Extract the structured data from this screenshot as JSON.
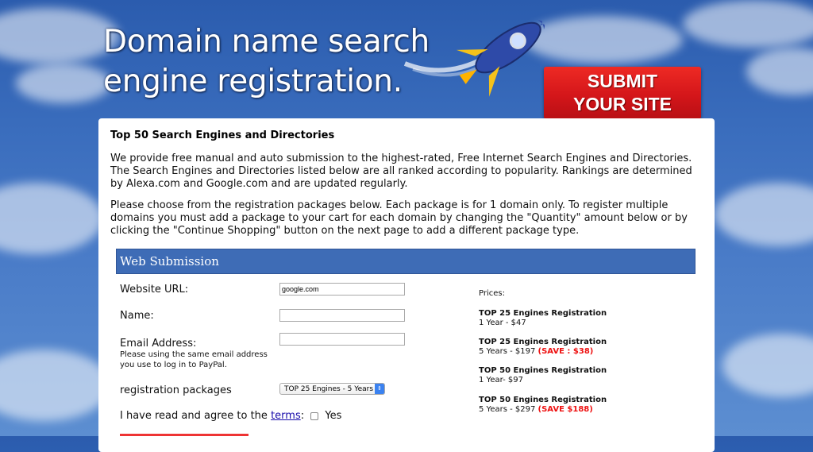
{
  "header": {
    "headline_line1": "Domain name search",
    "headline_line2": "engine registration.",
    "submit_line1": "SUBMIT",
    "submit_line2": "YOUR SITE"
  },
  "content": {
    "title": "Top 50 Search Engines and Directories",
    "paragraph1": "We provide free manual and auto submission to the highest-rated, Free Internet Search Engines and Directories. The Search Engines and Directories listed below are all ranked according to popularity. Rankings are determined by Alexa.com and Google.com and are updated regularly.",
    "paragraph2": "Please choose from the registration packages below. Each package is for 1 domain only. To register multiple domains you must add a package to your cart for each domain by changing the \"Quantity\" amount below or by clicking the \"Continue Shopping\" button on the next page to add a different package type."
  },
  "form": {
    "section_title": "Web Submission",
    "website_label": "Website URL:",
    "website_value": "google.com",
    "name_label": "Name:",
    "name_value": "",
    "email_label": "Email Address:",
    "email_value": "",
    "email_hint": "Please using the same email address you use to log in to PayPal.",
    "package_label": "registration packages",
    "package_selected": "TOP 25 Engines - 5 Years",
    "terms_prefix": "I have read and agree to the",
    "terms_link": "terms",
    "terms_colon": ":",
    "terms_yes": "Yes"
  },
  "prices": {
    "label": "Prices:",
    "items": [
      {
        "title": "TOP 25 Engines Registration",
        "detail": "1 Year - $47",
        "save": ""
      },
      {
        "title": "TOP 25 Engines Registration",
        "detail": "5 Years - $197",
        "save": "(SAVE : $38)"
      },
      {
        "title": "TOP 50 Engines Registration",
        "detail": "1 Year- $97",
        "save": ""
      },
      {
        "title": "TOP 50 Engines Registration",
        "detail": "5 Years - $297",
        "save": "(SAVE $188)"
      }
    ]
  },
  "colors": {
    "sky": "#3a6dbd",
    "submit_red": "#d4161a",
    "section_bar": "#3e6cb6",
    "save_red": "#e11111",
    "link_blue": "#1a0dab"
  },
  "icons": [
    "rocket-icon",
    "select-arrow-icon",
    "checkbox-icon"
  ]
}
